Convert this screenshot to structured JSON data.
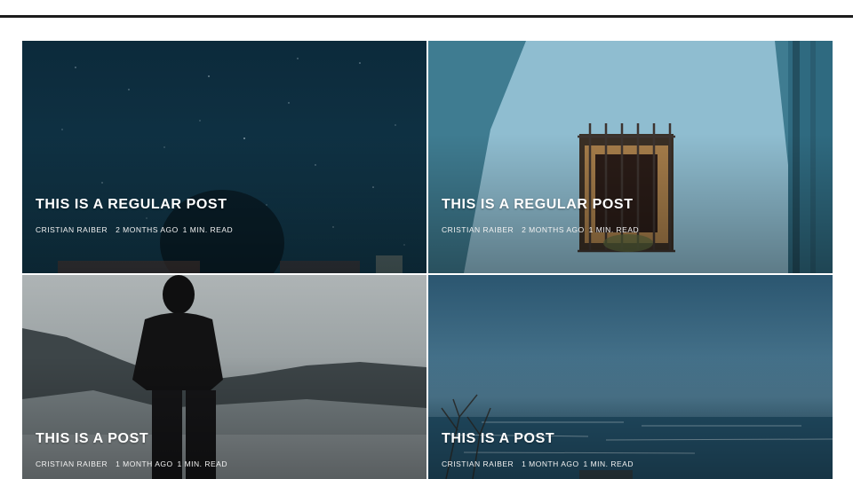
{
  "posts": [
    {
      "title": "THIS IS A REGULAR POST",
      "author": "CRISTIAN RAIBER",
      "date": "2 MONTHS AGO",
      "read_time": "1 MIN. READ",
      "image": "night-sky-person-photo"
    },
    {
      "title": "THIS IS A REGULAR POST",
      "author": "CRISTIAN RAIBER",
      "date": "2 MONTHS AGO",
      "read_time": "1 MIN. READ",
      "image": "blue-wall-window-photo"
    },
    {
      "title": "THIS IS A POST",
      "author": "CRISTIAN RAIBER",
      "date": "1 MONTH AGO",
      "read_time": "1 MIN. READ",
      "image": "person-foggy-mountains-photo"
    },
    {
      "title": "THIS IS A POST",
      "author": "CRISTIAN RAIBER",
      "date": "1 MONTH AGO",
      "read_time": "1 MIN. READ",
      "image": "ocean-beach-photo"
    }
  ],
  "colors": {
    "rule": "#1c1c1c",
    "title_text": "#ffffff"
  }
}
